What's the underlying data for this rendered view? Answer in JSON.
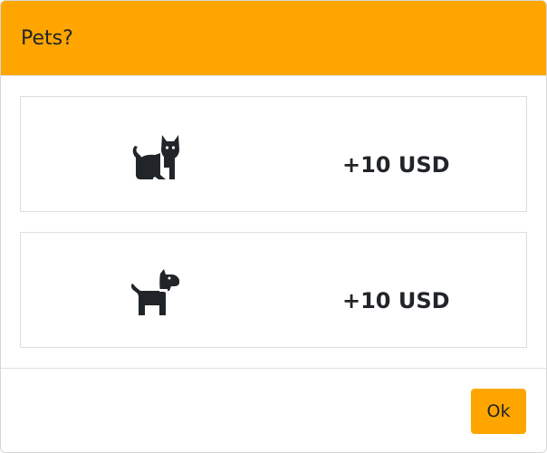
{
  "modal": {
    "title": "Pets?",
    "accent_color": "#ffa500"
  },
  "options": [
    {
      "icon": "cat-icon",
      "price": "+10 USD"
    },
    {
      "icon": "dog-icon",
      "price": "+10 USD"
    }
  ],
  "footer": {
    "ok_label": "Ok"
  }
}
